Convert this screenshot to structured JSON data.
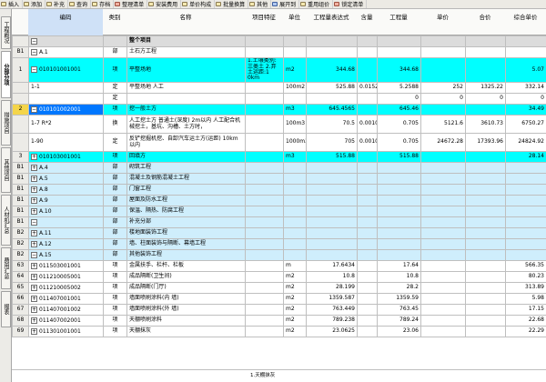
{
  "toolbar": {
    "items": [
      {
        "label": "插入",
        "icon": "insert-icon",
        "color": "plain"
      },
      {
        "label": "添加",
        "icon": "add-icon",
        "color": "plain"
      },
      {
        "label": "补充",
        "icon": "supplement-icon",
        "color": "plain"
      },
      {
        "label": "查询",
        "icon": "query-icon",
        "color": "plain"
      },
      {
        "label": "存档",
        "icon": "archive-icon",
        "color": "plain"
      },
      {
        "label": "整理清单",
        "icon": "sort-list-icon",
        "color": "red"
      },
      {
        "label": "安装费用",
        "icon": "install-cost-icon",
        "color": "plain"
      },
      {
        "label": "单价构成",
        "icon": "price-structure-icon",
        "color": "plain"
      },
      {
        "label": "批量换算",
        "icon": "batch-convert-icon",
        "color": "plain"
      },
      {
        "label": "其他",
        "icon": "other-icon",
        "color": "plain"
      },
      {
        "label": "展开到",
        "icon": "expand-to-icon",
        "color": "blue"
      },
      {
        "label": "重用组价",
        "icon": "reuse-price-icon",
        "color": "plain"
      },
      {
        "label": "锁定清单",
        "icon": "lock-list-icon",
        "color": "red"
      }
    ]
  },
  "sidebar": {
    "tabs": [
      {
        "label": "工程概况",
        "active": false
      },
      {
        "label": "分部分项",
        "active": true
      },
      {
        "label": "措施项目",
        "active": false
      },
      {
        "label": "其他项目",
        "active": false
      },
      {
        "label": "人材机汇总",
        "active": false
      },
      {
        "label": "费用汇总",
        "active": false
      },
      {
        "label": "报表",
        "active": false
      }
    ]
  },
  "header": {
    "columns": [
      "编码",
      "类别",
      "名称",
      "项目特征",
      "单位",
      "工程量表达式",
      "含量",
      "工程量",
      "单价",
      "合价",
      "综合单价"
    ]
  },
  "rows": [
    {
      "style": "summary",
      "num": "",
      "exp": "−",
      "indent": 1,
      "code": "",
      "cat": "",
      "name": "整个项目",
      "feature": "",
      "unit": "",
      "expr": "",
      "content": "",
      "qty": "",
      "price": "",
      "total": "",
      "uprice": "",
      "bold": true,
      "height": 12
    },
    {
      "style": "plain",
      "num": "B1",
      "exp": "−",
      "indent": 1,
      "code": "A.1",
      "cat": "部",
      "name": "土石方工程",
      "feature": "",
      "unit": "",
      "expr": "",
      "content": "",
      "qty": "",
      "price": "",
      "total": "",
      "uprice": "",
      "height": 12
    },
    {
      "style": "cyan",
      "num": "1",
      "exp": "−",
      "indent": 2,
      "code": "010101001001",
      "cat": "项",
      "name": "平整场地",
      "feature": "1.土壤类别: 三类土 2.弃土运距:1 0km",
      "unit": "m2",
      "expr": "344.68",
      "content": "",
      "qty": "344.68",
      "price": "",
      "total": "",
      "uprice": "5.07",
      "height": 27
    },
    {
      "style": "sub",
      "num": "",
      "exp": "",
      "indent": 3,
      "code": "1-1",
      "cat": "定",
      "name": "平整场地 人工",
      "feature": "",
      "unit": "100m2",
      "expr": "525.88",
      "content": "0.0152",
      "qty": "5.2588",
      "price": "252",
      "total": "1325.22",
      "uprice": "332.14",
      "height": 12
    },
    {
      "style": "sub",
      "num": "",
      "exp": "",
      "indent": 3,
      "code": "",
      "cat": "定",
      "name": "",
      "feature": "",
      "unit": "",
      "expr": "",
      "content": "",
      "qty": "0",
      "price": "0",
      "total": "0",
      "uprice": "0",
      "height": 12
    },
    {
      "style": "cyan2",
      "num": "2",
      "exp": "−",
      "indent": 2,
      "code": "010101002001",
      "cat": "项",
      "name": "挖一般土方",
      "feature": "",
      "unit": "m3",
      "expr": "645.4565",
      "content": "",
      "qty": "645.46",
      "price": "",
      "total": "",
      "uprice": "34.49",
      "sel": true,
      "height": 12
    },
    {
      "style": "sub",
      "num": "",
      "exp": "",
      "indent": 3,
      "code": "1-7 R*2",
      "cat": "换",
      "name": "人工挖土方 普通土(深度) 2m以内 人工配合机械挖土，基坑、沟槽、土方时，",
      "feature": "",
      "unit": "100m3",
      "expr": "70.5",
      "content": "0.0010922",
      "qty": "0.705",
      "price": "5121.6",
      "total": "3610.73",
      "uprice": "6750.27",
      "height": 20
    },
    {
      "style": "sub",
      "num": "",
      "exp": "",
      "indent": 3,
      "code": "1-90",
      "cat": "定",
      "name": "反铲挖掘机挖、自卸汽车运土方(运距) 10km以内",
      "feature": "",
      "unit": "1000m3",
      "expr": "705",
      "content": "0.0010922",
      "qty": "0.705",
      "price": "24672.28",
      "total": "17393.96",
      "uprice": "24824.92",
      "height": 20
    },
    {
      "style": "cyan",
      "num": "3",
      "exp": "+",
      "indent": 2,
      "code": "010103001001",
      "cat": "项",
      "name": "回填方",
      "feature": "",
      "unit": "m3",
      "expr": "515.88",
      "content": "",
      "qty": "515.88",
      "price": "",
      "total": "",
      "uprice": "28.14",
      "height": 12
    },
    {
      "style": "light",
      "num": "B1",
      "exp": "+",
      "indent": 1,
      "code": "A.4",
      "cat": "部",
      "name": "砌筑工程",
      "feature": "",
      "unit": "",
      "expr": "",
      "content": "",
      "qty": "",
      "price": "",
      "total": "",
      "uprice": "",
      "height": 12
    },
    {
      "style": "light",
      "num": "B1",
      "exp": "+",
      "indent": 1,
      "code": "A.5",
      "cat": "部",
      "name": "混凝土及钢筋混凝土工程",
      "feature": "",
      "unit": "",
      "expr": "",
      "content": "",
      "qty": "",
      "price": "",
      "total": "",
      "uprice": "",
      "height": 12
    },
    {
      "style": "light",
      "num": "B1",
      "exp": "+",
      "indent": 1,
      "code": "A.8",
      "cat": "部",
      "name": "门窗工程",
      "feature": "",
      "unit": "",
      "expr": "",
      "content": "",
      "qty": "",
      "price": "",
      "total": "",
      "uprice": "",
      "height": 12
    },
    {
      "style": "light",
      "num": "B1",
      "exp": "+",
      "indent": 1,
      "code": "A.9",
      "cat": "部",
      "name": "屋面及防水工程",
      "feature": "",
      "unit": "",
      "expr": "",
      "content": "",
      "qty": "",
      "price": "",
      "total": "",
      "uprice": "",
      "height": 12
    },
    {
      "style": "light",
      "num": "B1",
      "exp": "+",
      "indent": 1,
      "code": "A.10",
      "cat": "部",
      "name": "保温、隔热、防腐工程",
      "feature": "",
      "unit": "",
      "expr": "",
      "content": "",
      "qty": "",
      "price": "",
      "total": "",
      "uprice": "",
      "height": 12
    },
    {
      "style": "light",
      "num": "B1",
      "exp": "−",
      "indent": 1,
      "code": "",
      "cat": "部",
      "name": "补充分部",
      "feature": "",
      "unit": "",
      "expr": "",
      "content": "",
      "qty": "",
      "price": "",
      "total": "",
      "uprice": "",
      "height": 12
    },
    {
      "style": "light",
      "num": "B2",
      "exp": "+",
      "indent": 2,
      "code": "A.11",
      "cat": "部",
      "name": "楼地面装饰工程",
      "feature": "",
      "unit": "",
      "expr": "",
      "content": "",
      "qty": "",
      "price": "",
      "total": "",
      "uprice": "",
      "height": 12
    },
    {
      "style": "light",
      "num": "B2",
      "exp": "+",
      "indent": 2,
      "code": "A.12",
      "cat": "部",
      "name": "墙、柱面装饰与隔断、幕墙工程",
      "feature": "",
      "unit": "",
      "expr": "",
      "content": "",
      "qty": "",
      "price": "",
      "total": "",
      "uprice": "",
      "height": 12
    },
    {
      "style": "light",
      "num": "B2",
      "exp": "−",
      "indent": 2,
      "code": "A.15",
      "cat": "部",
      "name": "其他装饰工程",
      "feature": "",
      "unit": "",
      "expr": "",
      "content": "",
      "qty": "",
      "price": "",
      "total": "",
      "uprice": "",
      "height": 12
    },
    {
      "style": "plain",
      "num": "63",
      "exp": "+",
      "indent": 2,
      "code": "011503001001",
      "cat": "项",
      "name": "金属扶手、栏杆、栏板",
      "feature": "",
      "unit": "m",
      "expr": "17.6434",
      "content": "",
      "qty": "17.64",
      "price": "",
      "total": "",
      "uprice": "566.35",
      "height": 12
    },
    {
      "style": "plain",
      "num": "64",
      "exp": "+",
      "indent": 2,
      "code": "011210005001",
      "cat": "项",
      "name": "成品隔断(卫生间)",
      "feature": "",
      "unit": "m2",
      "expr": "10.8",
      "content": "",
      "qty": "10.8",
      "price": "",
      "total": "",
      "uprice": "80.23",
      "height": 12
    },
    {
      "style": "plain",
      "num": "65",
      "exp": "+",
      "indent": 2,
      "code": "011210005002",
      "cat": "项",
      "name": "成品隔断(门厅)",
      "feature": "",
      "unit": "m2",
      "expr": "28.199",
      "content": "",
      "qty": "28.2",
      "price": "",
      "total": "",
      "uprice": "313.89",
      "height": 12
    },
    {
      "style": "plain",
      "num": "66",
      "exp": "+",
      "indent": 2,
      "code": "011407001001",
      "cat": "项",
      "name": "墙面喷刷涂料(内 墙)",
      "feature": "",
      "unit": "m2",
      "expr": "1359.587",
      "content": "",
      "qty": "1359.59",
      "price": "",
      "total": "",
      "uprice": "5.98",
      "height": 12
    },
    {
      "style": "plain",
      "num": "67",
      "exp": "+",
      "indent": 2,
      "code": "011407001002",
      "cat": "项",
      "name": "墙面喷刷涂料(外 墙)",
      "feature": "",
      "unit": "m2",
      "expr": "763.449",
      "content": "",
      "qty": "763.45",
      "price": "",
      "total": "",
      "uprice": "17.15",
      "height": 12
    },
    {
      "style": "plain",
      "num": "68",
      "exp": "+",
      "indent": 2,
      "code": "011407002001",
      "cat": "项",
      "name": "天棚喷刷涂料",
      "feature": "",
      "unit": "m2",
      "expr": "789.238",
      "content": "",
      "qty": "789.24",
      "price": "",
      "total": "",
      "uprice": "22.68",
      "height": 12
    },
    {
      "style": "plain",
      "num": "69",
      "exp": "+",
      "indent": 2,
      "code": "011301001001",
      "cat": "项",
      "name": "天棚抹灰",
      "feature": "",
      "unit": "m2",
      "expr": "23.0625",
      "content": "",
      "qty": "23.06",
      "price": "",
      "total": "",
      "uprice": "22.29",
      "height": 12
    }
  ],
  "bottom": {
    "label": "1.天棚抹灰"
  },
  "colors": {
    "cyan": "#00ffff",
    "light_cyan": "#cfeefc",
    "selection": "#0077ff",
    "row_highlight": "#f4d54a"
  }
}
